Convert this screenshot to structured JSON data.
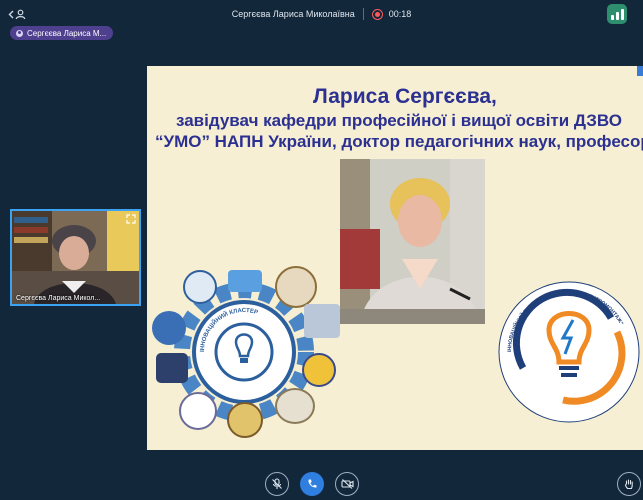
{
  "header": {
    "participant_name": "Сергєєва Лариса Миколаївна",
    "recording_time": "00:18"
  },
  "speaker_chip": {
    "label": "Сергєєва Лариса М..."
  },
  "self_view": {
    "name": "Сергєєва Лариса Микол..."
  },
  "slide": {
    "line1": "Лариса Сергєєва,",
    "line2": "завідувач кафедри професійної і вищої освіти ДЗВО",
    "line3": "“УМО” НАПН України, доктор педагогічних наук, професор",
    "cluster_ring_text": "ІННОВАЦІЙНИЙ ВІДДІЛЕНИЙ КЛАСТЕР \"ЕЛЕКТРОМОНТАЖ\"",
    "gear_ring_text": "ІННОВАЦІЙНИЙ КЛАСТЕР"
  },
  "colors": {
    "app_background": "#12273a",
    "accent_blue": "#2f7fe0",
    "speaker_chip": "#4f3f8f",
    "signal_green": "#2e8f6e",
    "recording_red": "#ff5a5a",
    "slide_background": "#f6efd3",
    "slide_text": "#2c3191",
    "cluster_orange": "#f08a24",
    "cluster_navy": "#1f3f7a"
  },
  "icons": {
    "back": "back-arrow-icon",
    "signal": "signal-strength-icon",
    "recording": "record-icon",
    "mic": "mic-off-icon",
    "end_call": "phone-icon",
    "camera": "camera-off-icon",
    "hand": "raise-hand-icon",
    "expand": "expand-icon"
  }
}
